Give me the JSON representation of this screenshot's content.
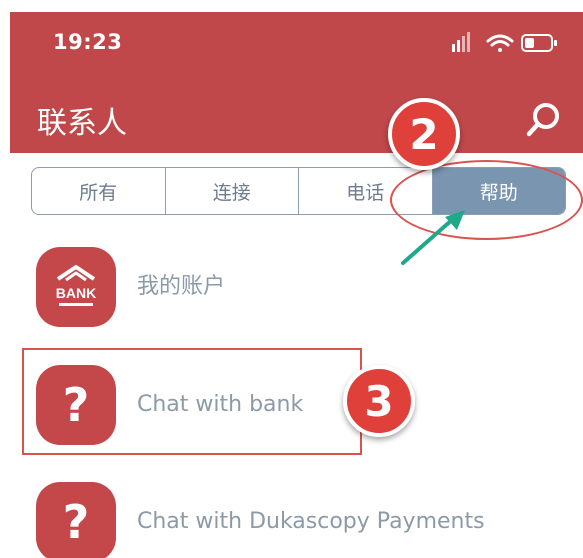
{
  "status_bar": {
    "time": "19:23"
  },
  "nav": {
    "title": "联系人",
    "search_icon": "search-icon"
  },
  "tabs": [
    {
      "label": "所有",
      "active": false
    },
    {
      "label": "连接",
      "active": false
    },
    {
      "label": "电话",
      "active": false
    },
    {
      "label": "帮助",
      "active": true
    }
  ],
  "list": [
    {
      "label": "我的账户",
      "icon": "bank-icon",
      "icon_text": "BANK"
    },
    {
      "label": "Chat with bank",
      "icon": "question-icon",
      "icon_text": "?"
    },
    {
      "label": "Chat with Dukascopy Payments",
      "icon": "question-icon",
      "icon_text": "?"
    }
  ],
  "annotations": {
    "badge_2": "2",
    "badge_3": "3"
  },
  "colors": {
    "header": "#c0484a",
    "active_tab": "#7a95b0",
    "annotation": "#d9534f",
    "arrow": "#1fa88a"
  }
}
